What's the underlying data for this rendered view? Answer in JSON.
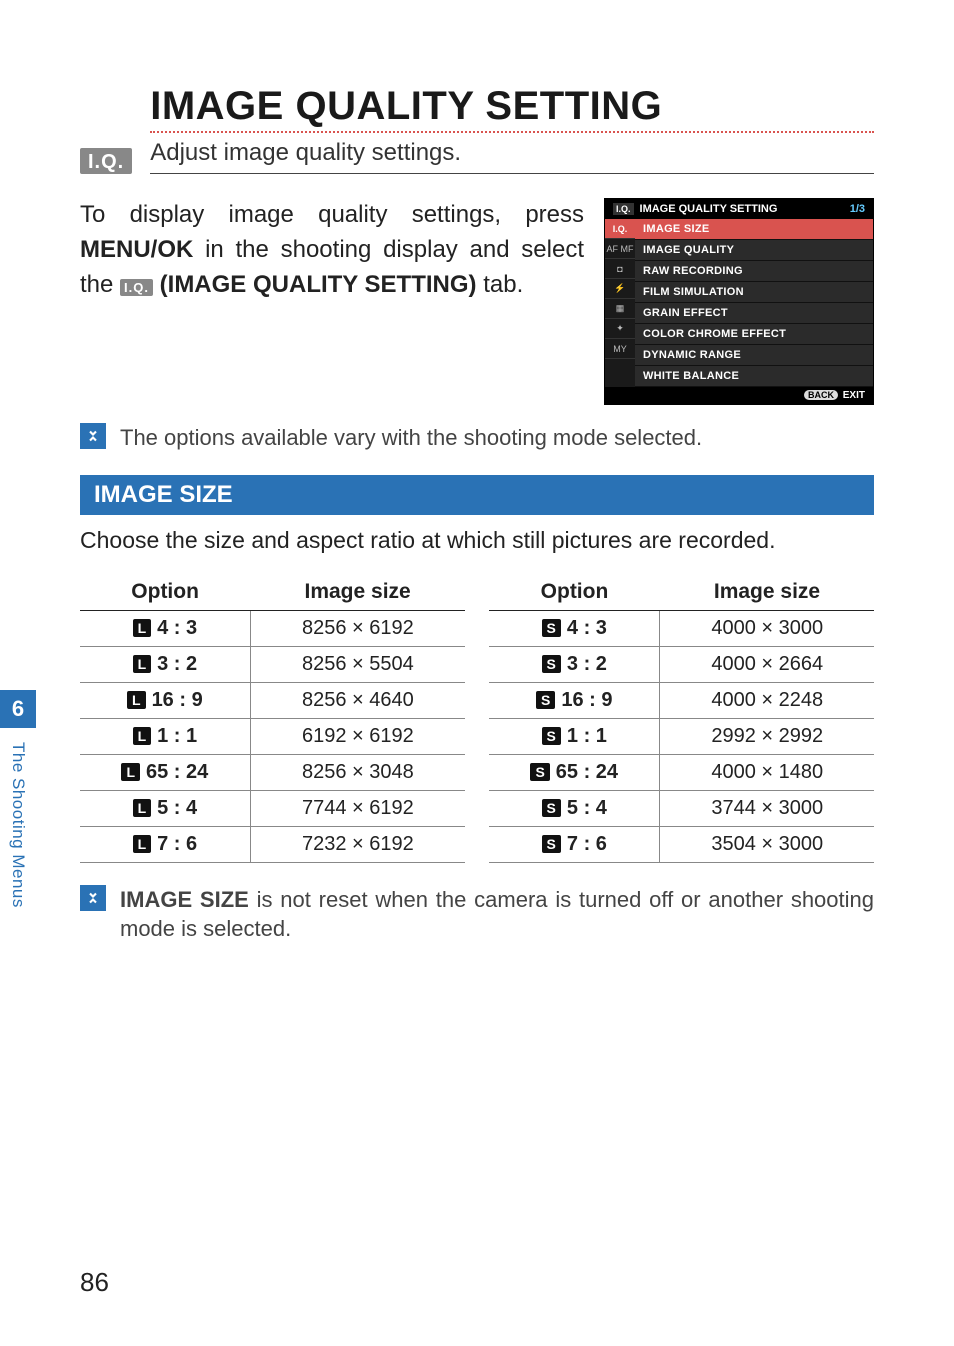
{
  "chapter_number": "6",
  "side_tab_label": "The Shooting Menus",
  "page_number": "86",
  "heading": {
    "badge": "I.Q.",
    "title": "IMAGE QUALITY SETTING",
    "subtitle": "Adjust image quality settings."
  },
  "intro": {
    "before_menu": "To display image quality settings, press ",
    "menu_ok": "MENU/OK",
    "after_menu": " in the shooting display and select the ",
    "iq_symbol": "I.Q.",
    "setting_label": " (IMAGE QUALITY SETTING)",
    "after_setting": " tab."
  },
  "menu_sim": {
    "title": "IMAGE QUALITY SETTING",
    "title_badge": "I.Q.",
    "page": "1/3",
    "tabs": [
      "I.Q.",
      "AF MF",
      "◘",
      "⚡",
      "▦",
      "✦",
      "MY"
    ],
    "items": [
      "IMAGE SIZE",
      "IMAGE QUALITY",
      "RAW RECORDING",
      "FILM SIMULATION",
      "GRAIN EFFECT",
      "COLOR CHROME EFFECT",
      "DYNAMIC RANGE",
      "WHITE BALANCE"
    ],
    "footer_back": "BACK",
    "footer_exit": "EXIT"
  },
  "note1": "The options available vary with the shooting mode selected.",
  "section": {
    "bar": "IMAGE SIZE",
    "text": "Choose the size and aspect ratio at which still pictures are recorded."
  },
  "table_headers": {
    "option": "Option",
    "size": "Image size"
  },
  "table_left": {
    "badge": "L",
    "rows": [
      {
        "ratio": "4 : 3",
        "size": "8256 × 6192"
      },
      {
        "ratio": "3 : 2",
        "size": "8256 × 5504"
      },
      {
        "ratio": "16 : 9",
        "size": "8256 × 4640"
      },
      {
        "ratio": "1 : 1",
        "size": "6192 × 6192"
      },
      {
        "ratio": "65 : 24",
        "size": "8256 × 3048"
      },
      {
        "ratio": "5 : 4",
        "size": "7744 × 6192"
      },
      {
        "ratio": "7 : 6",
        "size": "7232 × 6192"
      }
    ]
  },
  "table_right": {
    "badge": "S",
    "rows": [
      {
        "ratio": "4 : 3",
        "size": "4000 × 3000"
      },
      {
        "ratio": "3 : 2",
        "size": "4000 × 2664"
      },
      {
        "ratio": "16 : 9",
        "size": "4000 × 2248"
      },
      {
        "ratio": "1 : 1",
        "size": "2992 × 2992"
      },
      {
        "ratio": "65 : 24",
        "size": "4000 × 1480"
      },
      {
        "ratio": "5 : 4",
        "size": "3744 × 3000"
      },
      {
        "ratio": "7 : 6",
        "size": "3504 × 3000"
      }
    ]
  },
  "note2": {
    "bold": "IMAGE SIZE",
    "rest": " is not reset when the camera is turned off or another shooting mode is selected."
  }
}
